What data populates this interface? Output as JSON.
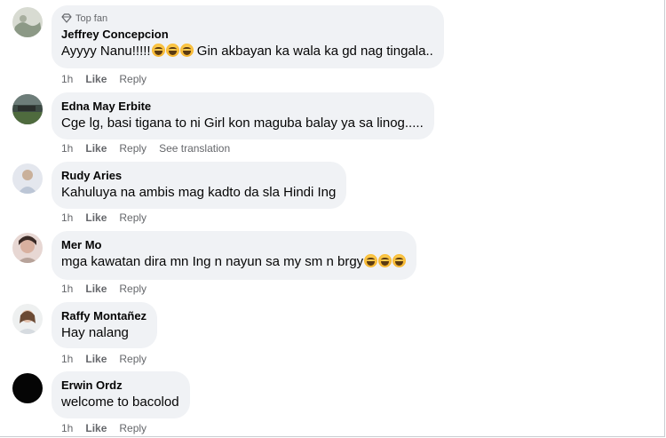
{
  "comments": [
    {
      "badge": "Top fan",
      "name": "Jeffrey Concepcion",
      "text": "Ayyyy Nanu!!!!!",
      "text_after": " Gin akbayan ka wala ka gd nag tingala..",
      "emoji_count": 3,
      "time": "1h",
      "like": "Like",
      "reply": "Reply",
      "translate": ""
    },
    {
      "name": "Edna May Erbite",
      "text": "Cge lg, basi tigana to ni Girl kon maguba balay ya sa linog.....",
      "time": "1h",
      "like": "Like",
      "reply": "Reply",
      "translate": "See translation"
    },
    {
      "name": "Rudy Aries",
      "text": "Kahuluya na ambis mag kadto da sla Hindi Ing",
      "time": "1h",
      "like": "Like",
      "reply": "Reply",
      "translate": ""
    },
    {
      "name": "Mer Mo",
      "text": "mga kawatan dira mn Ing n nayun sa my sm n brgy",
      "emoji_count": 3,
      "time": "1h",
      "like": "Like",
      "reply": "Reply",
      "translate": ""
    },
    {
      "name": "Raffy Montañez",
      "text": "Hay nalang",
      "time": "1h",
      "like": "Like",
      "reply": "Reply",
      "translate": ""
    },
    {
      "name": "Erwin Ordz",
      "text": "welcome to bacolod",
      "time": "1h",
      "like": "Like",
      "reply": "Reply",
      "translate": ""
    }
  ],
  "colors": {
    "bubble": "#f0f2f5",
    "meta": "#65676b",
    "text": "#050505"
  }
}
